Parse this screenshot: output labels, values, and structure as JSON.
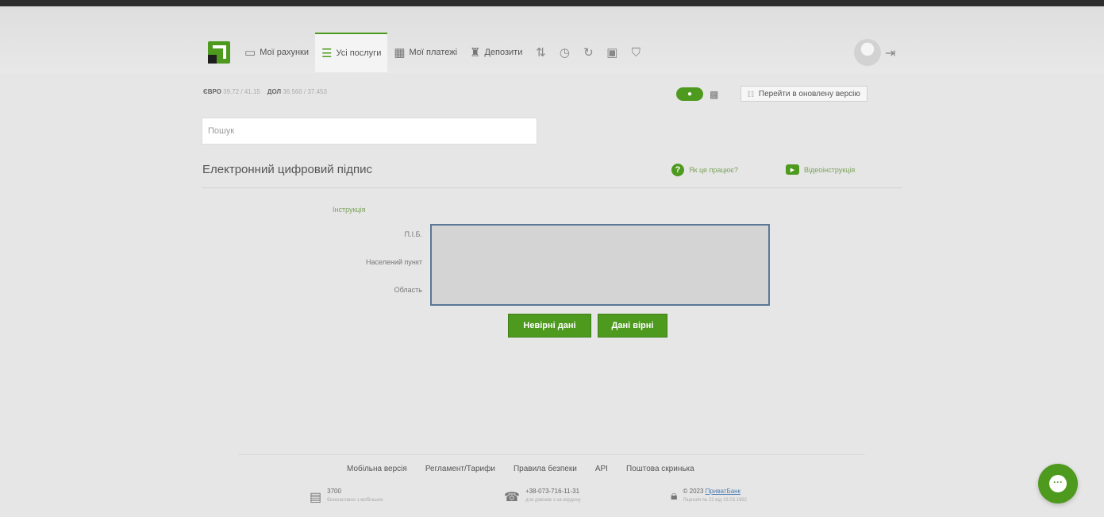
{
  "nav": {
    "items": [
      {
        "label": "Мої рахунки",
        "icon": "wallet-icon",
        "active": false
      },
      {
        "label": "Усі послуги",
        "icon": "list-icon",
        "active": true
      },
      {
        "label": "Мої платежі",
        "icon": "payments-icon",
        "active": false
      },
      {
        "label": "Депозити",
        "icon": "deposit-icon",
        "active": false
      }
    ],
    "icons": [
      "transfer-icon",
      "clock-icon",
      "refresh-icon",
      "gift-icon",
      "cart-icon"
    ]
  },
  "rates": {
    "eur_label": "ЄВРО",
    "eur_value": "39.72 / 41.15",
    "usd_label": "ДОЛ",
    "usd_value": "36.560 / 37.453"
  },
  "new_version": "Перейти в оновлену версію",
  "search": {
    "placeholder": "Пошук"
  },
  "page": {
    "title": "Електронний цифровий підпис",
    "how_it_works": "Як це працює?",
    "video_instruction": "Відеоінструкція"
  },
  "form": {
    "instruction_link": "Інструкція",
    "fields": [
      "П.І.Б.",
      "Населений пункт",
      "Область"
    ],
    "wrong_button": "Невірні дані",
    "correct_button": "Дані вірні"
  },
  "footer": {
    "links": [
      "Мобільна версія",
      "Регламент/Тарифи",
      "Правила безпеки",
      "API",
      "Поштова скринька"
    ],
    "contacts": [
      {
        "icon": "mobile-icon",
        "line1": "3700",
        "line2": "безкоштовно з мобільних"
      },
      {
        "icon": "phone-icon",
        "line1": "+38-073-716-11-31",
        "line2": "для дзвінків з-за кордону"
      },
      {
        "icon": "lock-icon",
        "line1": "© 2023",
        "brand": "ПриватБанк",
        "line2": "Ліцензія № 22 від 19.03.1992"
      }
    ]
  },
  "colors": {
    "accent": "#4e9a1f",
    "background": "#e6e6e6"
  }
}
